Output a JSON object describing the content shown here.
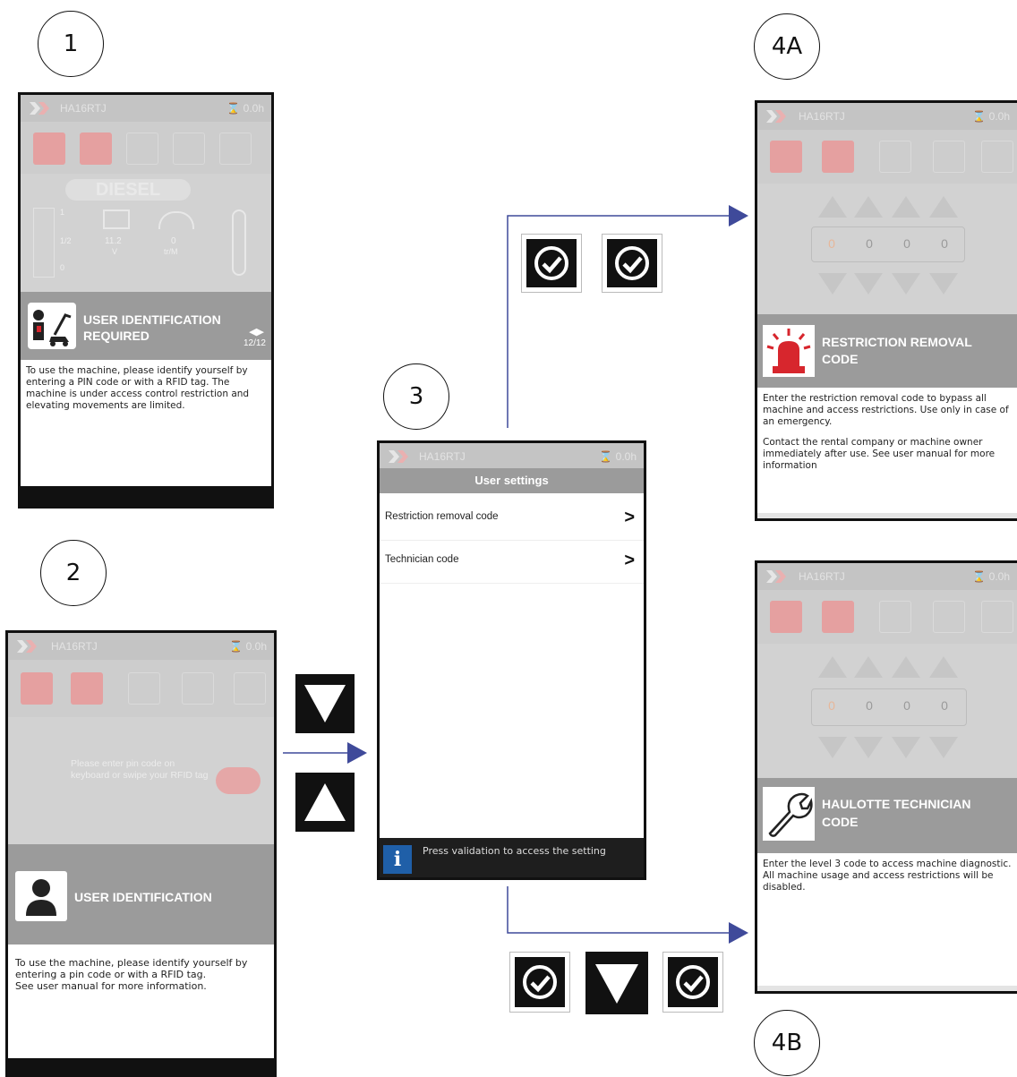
{
  "steps": {
    "s1": "1",
    "s2": "2",
    "s3": "3",
    "s4a": "4A",
    "s4b": "4B"
  },
  "topbar": {
    "model": "HA16RTJ",
    "hours": "0.0h"
  },
  "screen1": {
    "fuel": "DIESEL",
    "gauge_full": "1",
    "gauge_half": "1/2",
    "gauge_empty": "0",
    "battery_value": "11.2",
    "battery_unit": "V",
    "rpm_value": "0",
    "rpm_unit": "tr/M",
    "title_line1": "USER IDENTIFICATION",
    "title_line2": "REQUIRED",
    "page": "12/12",
    "body": "To use the machine, please identify yourself by entering a PIN code or with a RFID tag. The machine is under access control restriction and elevating movements are limited."
  },
  "screen2": {
    "prompt": "Please enter pin code on keyboard or swipe your RFID tag",
    "title": "USER IDENTIFICATION",
    "body_line1": "To use the machine, please identify yourself by",
    "body_line2": "entering a pin code or with a RFID tag.",
    "body_line3": "See user manual for more information."
  },
  "screen3": {
    "header": "User settings",
    "items": [
      {
        "label": "Restriction removal code"
      },
      {
        "label": "Technician code"
      }
    ],
    "info": "Press validation to access the setting"
  },
  "screen4a": {
    "digits": [
      "0",
      "0",
      "0",
      "0"
    ],
    "title_line1": "RESTRICTION REMOVAL",
    "title_line2": "CODE",
    "body1": "Enter the restriction removal code to bypass all machine and access restrictions. Use only in case of an emergency.",
    "body2": "Contact the rental company or machine owner immediately after use. See user manual for more information"
  },
  "screen4b": {
    "digits": [
      "0",
      "0",
      "0",
      "0"
    ],
    "title_line1": "HAULOTTE TECHNICIAN",
    "title_line2": "CODE",
    "body": "Enter the level 3 code to access machine diagnostic. All machine usage and access restrictions will be disabled."
  },
  "colors": {
    "arrow": "#3f4a9a",
    "info_icon": "#1f5fa8",
    "alarm": "#d7262d"
  }
}
